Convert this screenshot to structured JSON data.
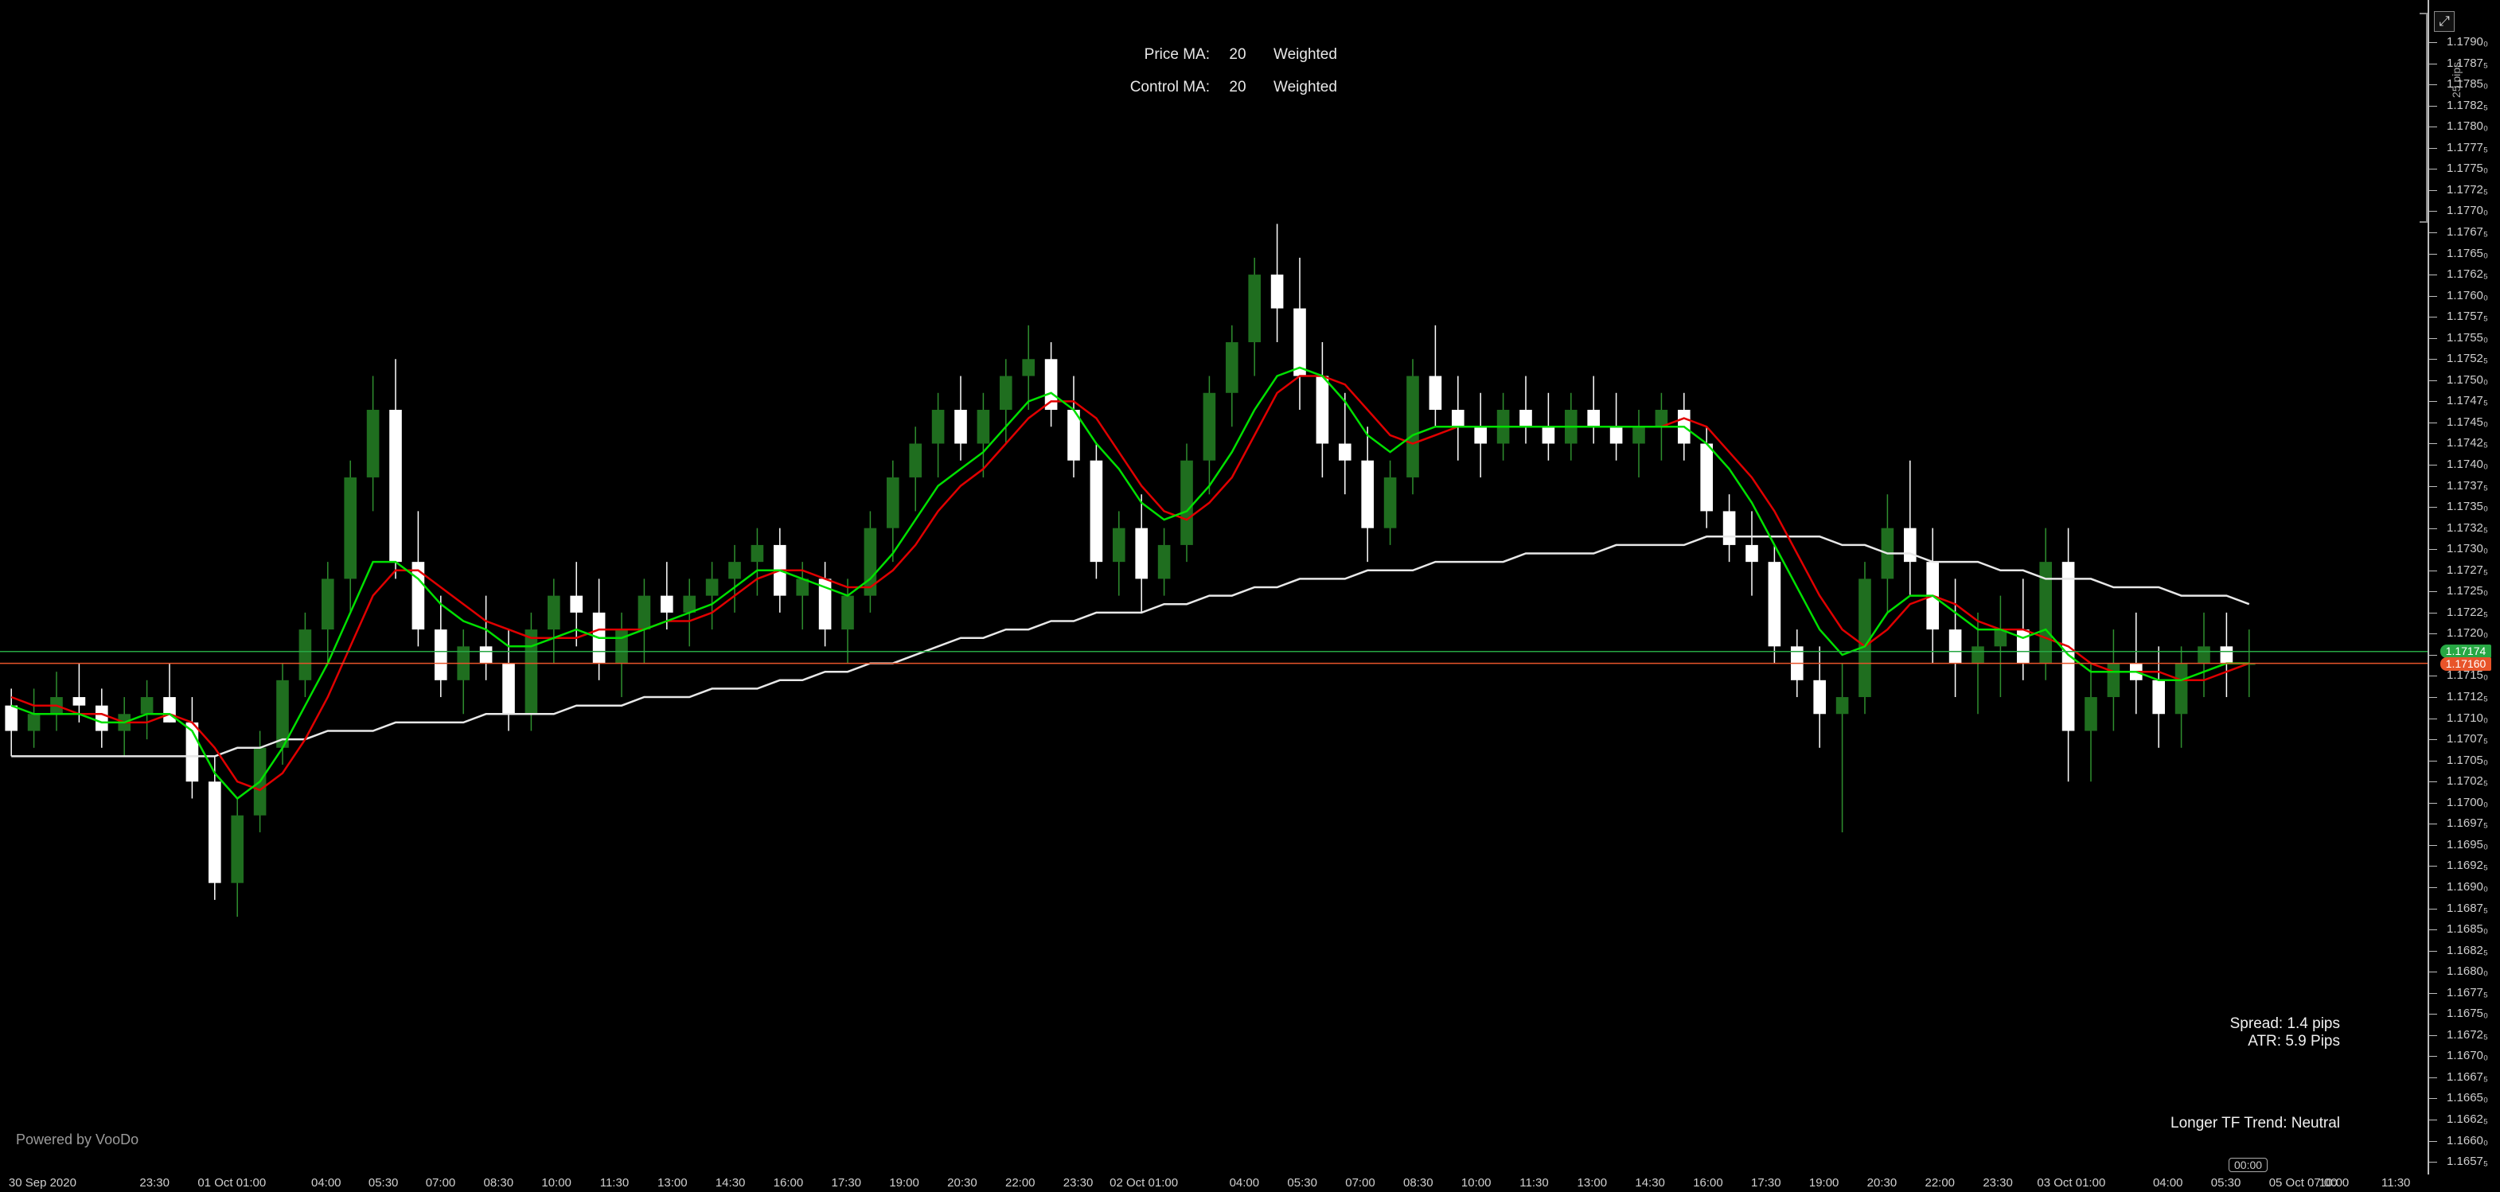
{
  "ma_panel": {
    "price_ma_label": "Price MA:",
    "price_ma_period": "20",
    "price_ma_type": "Weighted",
    "control_ma_label": "Control MA:",
    "control_ma_period": "20",
    "control_ma_type": "Weighted"
  },
  "info": {
    "spread": "Spread: 1.4 pips",
    "atr": "ATR: 5.9 Pips",
    "trend": "Longer TF Trend: Neutral"
  },
  "powered_by": "Powered by VooDo",
  "current_time_tag": "00:00",
  "pips_scale_label": "25 pips",
  "icons": {
    "expand": "expand-icon"
  },
  "colors": {
    "background": "#000000",
    "bull_candle": "#1f6e1f",
    "bear_candle": "#ffffff",
    "price_ma": "#00e000",
    "control_ma": "#e00000",
    "long_ma": "#e8e8e8",
    "bid_line": "#27a844",
    "ask_line": "#e8542a"
  },
  "price_tags": {
    "bid": "1.17174",
    "ask": "1.17160"
  },
  "chart_data": {
    "type": "candlestick",
    "symbol_timeframe_hint": "EURUSD intraday",
    "ylim": [
      1.16555,
      1.17945
    ],
    "y_ticks": [
      "1.1757₅",
      "1.1770₀",
      "1.1762₅",
      "1.1765₀",
      "1.1767₅",
      "1.1770₀"
    ],
    "y_tick_values": [
      1.1657,
      1.16595,
      1.1662,
      1.16645,
      1.1667,
      1.16695,
      1.1672,
      1.16745,
      1.1677,
      1.16795,
      1.1682,
      1.16845,
      1.1687,
      1.16895,
      1.1692,
      1.16945,
      1.1697,
      1.16995,
      1.1702,
      1.17045,
      1.1707,
      1.17095,
      1.1712,
      1.17145,
      1.1717,
      1.17195,
      1.1722,
      1.17245,
      1.1727,
      1.17295,
      1.1732,
      1.17345,
      1.1737,
      1.17395,
      1.1742,
      1.17445,
      1.1747,
      1.17495,
      1.1752,
      1.17545,
      1.1757,
      1.17595,
      1.1762,
      1.17645,
      1.1767,
      1.17695,
      1.1772,
      1.17745,
      1.1777,
      1.17795,
      1.1782,
      1.17845,
      1.1787,
      1.17895
    ],
    "y_tick_labels": [
      "1.1657₅",
      "1.1660₀",
      "1.1662₅",
      "1.1665₀",
      "1.1667₅",
      "1.1670₀",
      "1.1672₅",
      "1.1675₀",
      "1.1677₅",
      "1.1680₀",
      "1.1682₅",
      "1.1685₀",
      "1.1687₅",
      "1.1690₀",
      "1.1692₅",
      "1.1695₀",
      "1.1697₅",
      "1.1700₀",
      "1.1702₅",
      "1.1705₀",
      "1.1707₅",
      "1.1710₀",
      "1.1712₅",
      "1.1715₀",
      "1.1717₅",
      "1.1720₀",
      "1.1722₅",
      "1.1725₀",
      "1.1727₅",
      "1.1730₀",
      "1.1732₅",
      "1.1735₀",
      "1.1737₅",
      "1.1740₀",
      "1.1742₅",
      "1.1745₀",
      "1.1747₅",
      "1.1750₀",
      "1.1752₅",
      "1.1755₀",
      "1.1757₅",
      "1.1760₀",
      "1.1762₅",
      "1.1765₀",
      "1.1767₅",
      "1.1770₀",
      "1.1772₅",
      "1.1775₀",
      "1.1777₅",
      "1.1780₀",
      "1.1782₅",
      "1.1785₀",
      "1.1787₅",
      "1.1790₀"
    ],
    "x_labels": [
      "30 Sep 2020",
      "23:30",
      "01 Oct 01:00",
      "04:00",
      "05:30",
      "07:00",
      "08:30",
      "10:00",
      "11:30",
      "13:00",
      "14:30",
      "16:00",
      "17:30",
      "19:00",
      "20:30",
      "22:00",
      "23:30",
      "02 Oct 01:00",
      "04:00",
      "05:30",
      "07:00",
      "08:30",
      "10:00",
      "11:30",
      "13:00",
      "14:30",
      "16:00",
      "17:30",
      "19:00",
      "20:30",
      "22:00",
      "23:30",
      "03 Oct 01:00",
      "04:00",
      "05:30",
      "05 Oct 07:00",
      "10:00",
      "11:30"
    ],
    "bid": 1.17174,
    "ask": 1.1716,
    "candles": [
      [
        1.1711,
        1.1713,
        1.1705,
        1.1708
      ],
      [
        1.1708,
        1.1713,
        1.1706,
        1.171
      ],
      [
        1.171,
        1.1715,
        1.1708,
        1.1712
      ],
      [
        1.1712,
        1.1716,
        1.1709,
        1.1711
      ],
      [
        1.1711,
        1.1713,
        1.1706,
        1.1708
      ],
      [
        1.1708,
        1.1712,
        1.1705,
        1.171
      ],
      [
        1.171,
        1.1714,
        1.1707,
        1.1712
      ],
      [
        1.1712,
        1.1716,
        1.1709,
        1.1709
      ],
      [
        1.1709,
        1.1712,
        1.17,
        1.1702
      ],
      [
        1.1702,
        1.1705,
        1.1688,
        1.169
      ],
      [
        1.169,
        1.17,
        1.1686,
        1.1698
      ],
      [
        1.1698,
        1.1708,
        1.1696,
        1.1706
      ],
      [
        1.1706,
        1.1716,
        1.1704,
        1.1714
      ],
      [
        1.1714,
        1.1722,
        1.1712,
        1.172
      ],
      [
        1.172,
        1.1728,
        1.1716,
        1.1726
      ],
      [
        1.1726,
        1.174,
        1.1722,
        1.1738
      ],
      [
        1.1738,
        1.175,
        1.1734,
        1.1746
      ],
      [
        1.1746,
        1.1752,
        1.1726,
        1.1728
      ],
      [
        1.1728,
        1.1734,
        1.1718,
        1.172
      ],
      [
        1.172,
        1.1724,
        1.1712,
        1.1714
      ],
      [
        1.1714,
        1.172,
        1.171,
        1.1718
      ],
      [
        1.1718,
        1.1724,
        1.1714,
        1.1716
      ],
      [
        1.1716,
        1.172,
        1.1708,
        1.171
      ],
      [
        1.171,
        1.1722,
        1.1708,
        1.172
      ],
      [
        1.172,
        1.1726,
        1.1716,
        1.1724
      ],
      [
        1.1724,
        1.1728,
        1.1718,
        1.1722
      ],
      [
        1.1722,
        1.1726,
        1.1714,
        1.1716
      ],
      [
        1.1716,
        1.1722,
        1.1712,
        1.172
      ],
      [
        1.172,
        1.1726,
        1.1716,
        1.1724
      ],
      [
        1.1724,
        1.1728,
        1.172,
        1.1722
      ],
      [
        1.1722,
        1.1726,
        1.1718,
        1.1724
      ],
      [
        1.1724,
        1.1728,
        1.172,
        1.1726
      ],
      [
        1.1726,
        1.173,
        1.1722,
        1.1728
      ],
      [
        1.1728,
        1.1732,
        1.1724,
        1.173
      ],
      [
        1.173,
        1.1732,
        1.1722,
        1.1724
      ],
      [
        1.1724,
        1.1728,
        1.172,
        1.1726
      ],
      [
        1.1726,
        1.1728,
        1.1718,
        1.172
      ],
      [
        1.172,
        1.1726,
        1.1716,
        1.1724
      ],
      [
        1.1724,
        1.1734,
        1.1722,
        1.1732
      ],
      [
        1.1732,
        1.174,
        1.1728,
        1.1738
      ],
      [
        1.1738,
        1.1744,
        1.1734,
        1.1742
      ],
      [
        1.1742,
        1.1748,
        1.1738,
        1.1746
      ],
      [
        1.1746,
        1.175,
        1.174,
        1.1742
      ],
      [
        1.1742,
        1.1748,
        1.1738,
        1.1746
      ],
      [
        1.1746,
        1.1752,
        1.1742,
        1.175
      ],
      [
        1.175,
        1.1756,
        1.1746,
        1.1752
      ],
      [
        1.1752,
        1.1754,
        1.1744,
        1.1746
      ],
      [
        1.1746,
        1.175,
        1.1738,
        1.174
      ],
      [
        1.174,
        1.1742,
        1.1726,
        1.1728
      ],
      [
        1.1728,
        1.1734,
        1.1724,
        1.1732
      ],
      [
        1.1732,
        1.1736,
        1.1722,
        1.1726
      ],
      [
        1.1726,
        1.1732,
        1.1724,
        1.173
      ],
      [
        1.173,
        1.1742,
        1.1728,
        1.174
      ],
      [
        1.174,
        1.175,
        1.1736,
        1.1748
      ],
      [
        1.1748,
        1.1756,
        1.1744,
        1.1754
      ],
      [
        1.1754,
        1.1764,
        1.175,
        1.1762
      ],
      [
        1.1762,
        1.1768,
        1.1754,
        1.1758
      ],
      [
        1.1758,
        1.1764,
        1.1746,
        1.175
      ],
      [
        1.175,
        1.1754,
        1.1738,
        1.1742
      ],
      [
        1.1742,
        1.1748,
        1.1736,
        1.174
      ],
      [
        1.174,
        1.1744,
        1.1728,
        1.1732
      ],
      [
        1.1732,
        1.174,
        1.173,
        1.1738
      ],
      [
        1.1738,
        1.1752,
        1.1736,
        1.175
      ],
      [
        1.175,
        1.1756,
        1.1744,
        1.1746
      ],
      [
        1.1746,
        1.175,
        1.174,
        1.1744
      ],
      [
        1.1744,
        1.1748,
        1.1738,
        1.1742
      ],
      [
        1.1742,
        1.1748,
        1.174,
        1.1746
      ],
      [
        1.1746,
        1.175,
        1.1742,
        1.1744
      ],
      [
        1.1744,
        1.1748,
        1.174,
        1.1742
      ],
      [
        1.1742,
        1.1748,
        1.174,
        1.1746
      ],
      [
        1.1746,
        1.175,
        1.1742,
        1.1744
      ],
      [
        1.1744,
        1.1748,
        1.174,
        1.1742
      ],
      [
        1.1742,
        1.1746,
        1.1738,
        1.1744
      ],
      [
        1.1744,
        1.1748,
        1.174,
        1.1746
      ],
      [
        1.1746,
        1.1748,
        1.174,
        1.1742
      ],
      [
        1.1742,
        1.1744,
        1.1732,
        1.1734
      ],
      [
        1.1734,
        1.1736,
        1.1728,
        1.173
      ],
      [
        1.173,
        1.1734,
        1.1724,
        1.1728
      ],
      [
        1.1728,
        1.173,
        1.1716,
        1.1718
      ],
      [
        1.1718,
        1.172,
        1.1712,
        1.1714
      ],
      [
        1.1714,
        1.1718,
        1.1706,
        1.171
      ],
      [
        1.171,
        1.1716,
        1.1696,
        1.1712
      ],
      [
        1.1712,
        1.1728,
        1.171,
        1.1726
      ],
      [
        1.1726,
        1.1736,
        1.1722,
        1.1732
      ],
      [
        1.1732,
        1.174,
        1.1724,
        1.1728
      ],
      [
        1.1728,
        1.1732,
        1.1716,
        1.172
      ],
      [
        1.172,
        1.1726,
        1.1712,
        1.1716
      ],
      [
        1.1716,
        1.1722,
        1.171,
        1.1718
      ],
      [
        1.1718,
        1.1724,
        1.1712,
        1.172
      ],
      [
        1.172,
        1.1726,
        1.1714,
        1.1716
      ],
      [
        1.1716,
        1.1732,
        1.1714,
        1.1728
      ],
      [
        1.1728,
        1.1732,
        1.1702,
        1.1708
      ],
      [
        1.1708,
        1.1716,
        1.1702,
        1.1712
      ],
      [
        1.1712,
        1.172,
        1.1708,
        1.1716
      ],
      [
        1.1716,
        1.1722,
        1.171,
        1.1714
      ],
      [
        1.1714,
        1.1718,
        1.1706,
        1.171
      ],
      [
        1.171,
        1.1718,
        1.1706,
        1.1716
      ],
      [
        1.1716,
        1.1722,
        1.1712,
        1.1718
      ],
      [
        1.1718,
        1.1722,
        1.1712,
        1.1716
      ],
      [
        1.1716,
        1.172,
        1.1712,
        1.1716
      ]
    ],
    "price_ma": [
      1.1711,
      1.171,
      1.171,
      1.171,
      1.1709,
      1.1709,
      1.171,
      1.171,
      1.1708,
      1.1703,
      1.17,
      1.1702,
      1.1706,
      1.1711,
      1.1716,
      1.1722,
      1.1728,
      1.1728,
      1.1726,
      1.1723,
      1.1721,
      1.172,
      1.1718,
      1.1718,
      1.1719,
      1.172,
      1.1719,
      1.1719,
      1.172,
      1.1721,
      1.1722,
      1.1723,
      1.1725,
      1.1727,
      1.1727,
      1.1726,
      1.1725,
      1.1724,
      1.1726,
      1.1729,
      1.1733,
      1.1737,
      1.1739,
      1.1741,
      1.1744,
      1.1747,
      1.1748,
      1.1746,
      1.1742,
      1.1739,
      1.1735,
      1.1733,
      1.1734,
      1.1737,
      1.1741,
      1.1746,
      1.175,
      1.1751,
      1.175,
      1.1747,
      1.1743,
      1.1741,
      1.1743,
      1.1744,
      1.1744,
      1.1744,
      1.1744,
      1.1744,
      1.1744,
      1.1744,
      1.1744,
      1.1744,
      1.1744,
      1.1744,
      1.1744,
      1.1742,
      1.1739,
      1.1735,
      1.173,
      1.1725,
      1.172,
      1.1717,
      1.1718,
      1.1722,
      1.1724,
      1.1724,
      1.1722,
      1.172,
      1.172,
      1.1719,
      1.172,
      1.1717,
      1.1715,
      1.1715,
      1.1715,
      1.1714,
      1.1714,
      1.1715,
      1.1716,
      1.1716
    ],
    "control_ma": [
      1.1712,
      1.1711,
      1.1711,
      1.171,
      1.171,
      1.1709,
      1.1709,
      1.171,
      1.1709,
      1.1706,
      1.1702,
      1.1701,
      1.1703,
      1.1707,
      1.1712,
      1.1718,
      1.1724,
      1.1727,
      1.1727,
      1.1725,
      1.1723,
      1.1721,
      1.172,
      1.1719,
      1.1719,
      1.1719,
      1.172,
      1.172,
      1.172,
      1.1721,
      1.1721,
      1.1722,
      1.1724,
      1.1726,
      1.1727,
      1.1727,
      1.1726,
      1.1725,
      1.1725,
      1.1727,
      1.173,
      1.1734,
      1.1737,
      1.1739,
      1.1742,
      1.1745,
      1.1747,
      1.1747,
      1.1745,
      1.1741,
      1.1737,
      1.1734,
      1.1733,
      1.1735,
      1.1738,
      1.1743,
      1.1748,
      1.175,
      1.175,
      1.1749,
      1.1746,
      1.1743,
      1.1742,
      1.1743,
      1.1744,
      1.1744,
      1.1744,
      1.1744,
      1.1744,
      1.1744,
      1.1744,
      1.1744,
      1.1744,
      1.1744,
      1.1745,
      1.1744,
      1.1741,
      1.1738,
      1.1734,
      1.1729,
      1.1724,
      1.172,
      1.1718,
      1.172,
      1.1723,
      1.1724,
      1.1723,
      1.1721,
      1.172,
      1.172,
      1.1719,
      1.1718,
      1.1716,
      1.1715,
      1.1715,
      1.1715,
      1.1714,
      1.1714,
      1.1715,
      1.1716
    ],
    "long_ma": [
      1.1705,
      1.1705,
      1.1705,
      1.1705,
      1.1705,
      1.1705,
      1.1705,
      1.1705,
      1.1705,
      1.1705,
      1.1706,
      1.1706,
      1.1707,
      1.1707,
      1.1708,
      1.1708,
      1.1708,
      1.1709,
      1.1709,
      1.1709,
      1.1709,
      1.171,
      1.171,
      1.171,
      1.171,
      1.1711,
      1.1711,
      1.1711,
      1.1712,
      1.1712,
      1.1712,
      1.1713,
      1.1713,
      1.1713,
      1.1714,
      1.1714,
      1.1715,
      1.1715,
      1.1716,
      1.1716,
      1.1717,
      1.1718,
      1.1719,
      1.1719,
      1.172,
      1.172,
      1.1721,
      1.1721,
      1.1722,
      1.1722,
      1.1722,
      1.1723,
      1.1723,
      1.1724,
      1.1724,
      1.1725,
      1.1725,
      1.1726,
      1.1726,
      1.1726,
      1.1727,
      1.1727,
      1.1727,
      1.1728,
      1.1728,
      1.1728,
      1.1728,
      1.1729,
      1.1729,
      1.1729,
      1.1729,
      1.173,
      1.173,
      1.173,
      1.173,
      1.1731,
      1.1731,
      1.1731,
      1.1731,
      1.1731,
      1.1731,
      1.173,
      1.173,
      1.1729,
      1.1729,
      1.1728,
      1.1728,
      1.1728,
      1.1727,
      1.1727,
      1.1726,
      1.1726,
      1.1726,
      1.1725,
      1.1725,
      1.1725,
      1.1724,
      1.1724,
      1.1724,
      1.1723
    ]
  }
}
